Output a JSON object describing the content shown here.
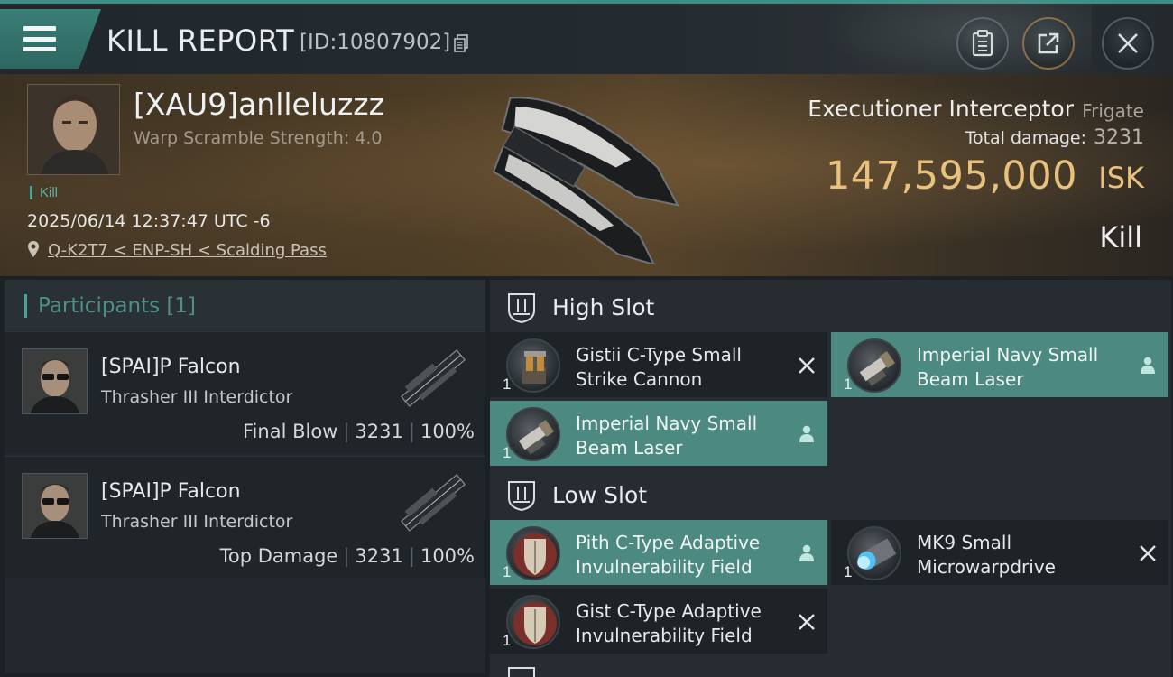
{
  "header": {
    "title": "KILL REPORT",
    "report_id": "[ID:10807902]"
  },
  "victim": {
    "name": "[XAU9]anlleluzzz",
    "warp_scramble": "Warp Scramble Strength: 4.0",
    "tag": "Kill",
    "datetime": "2025/06/14 12:37:47 UTC -6",
    "location": "Q-K2T7 < ENP-SH < Scalding Pass",
    "ship_name": "Executioner Interceptor",
    "ship_class": "Frigate",
    "total_damage_label": "Total damage:",
    "total_damage": "3231",
    "isk_value": "147,595,000",
    "isk_unit": "ISK",
    "result": "Kill"
  },
  "participants": {
    "title": "Participants [1]",
    "rows": [
      {
        "name": "[SPAI]P Falcon",
        "ship": "Thrasher III Interdictor",
        "role": "Final Blow",
        "damage": "3231",
        "percent": "100%"
      },
      {
        "name": "[SPAI]P Falcon",
        "ship": "Thrasher III Interdictor",
        "role": "Top Damage",
        "damage": "3231",
        "percent": "100%"
      }
    ]
  },
  "slots": {
    "high": {
      "label": "High Slot",
      "modules": [
        {
          "name": "Gistii C-Type Small Strike Cannon",
          "qty": "1",
          "status": "destroyed"
        },
        {
          "name": "Imperial Navy Small Beam Laser",
          "qty": "1",
          "status": "dropped"
        },
        {
          "name": "Imperial Navy Small Beam Laser",
          "qty": "1",
          "status": "dropped"
        }
      ]
    },
    "low": {
      "label": "Low Slot",
      "modules": [
        {
          "name": "Pith C-Type Adaptive Invulnerability Field",
          "qty": "1",
          "status": "dropped"
        },
        {
          "name": "MK9 Small Microwarpdrive",
          "qty": "1",
          "status": "destroyed"
        },
        {
          "name": "Gist C-Type Adaptive Invulnerability Field",
          "qty": "1",
          "status": "destroyed"
        }
      ]
    }
  },
  "colors": {
    "accent": "#4aa396",
    "isk": "#e8c27d",
    "dropped_bg": "#4c8a81",
    "destroyed_bg": "#1e2327"
  }
}
